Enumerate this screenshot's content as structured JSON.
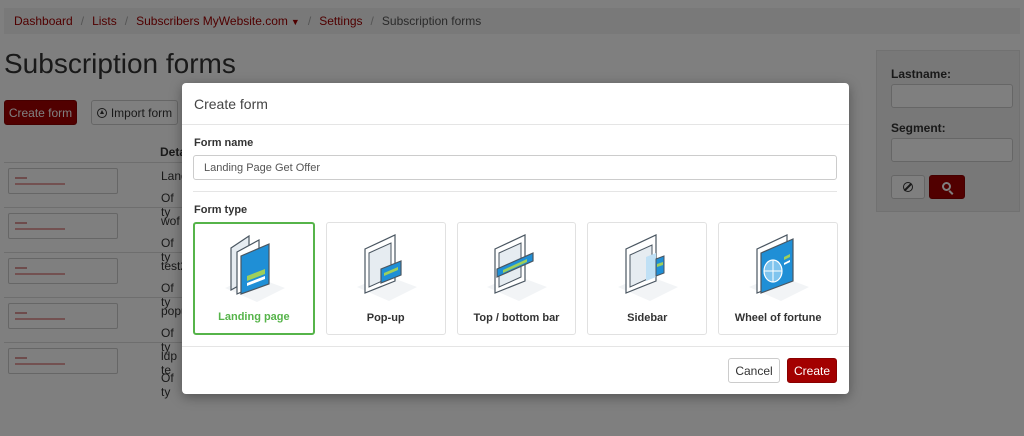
{
  "breadcrumb": {
    "items": [
      "Dashboard",
      "Lists",
      "Subscribers MyWebsite.com",
      "Settings"
    ],
    "current": "Subscription forms"
  },
  "page": {
    "title": "Subscription forms",
    "create_form_label": "Create form",
    "import_form_label": "Import form",
    "table_header_details": "Deta",
    "rows": [
      {
        "name": "Land",
        "type": "Of ty"
      },
      {
        "name": "wof",
        "type": "Of ty"
      },
      {
        "name": "test2",
        "type": "Of ty"
      },
      {
        "name": "popu",
        "type": "Of ty"
      },
      {
        "name": "ldp te",
        "type": "Of ty"
      }
    ]
  },
  "side_panel": {
    "lastname_label": "Lastname:",
    "segment_label": "Segment:"
  },
  "modal": {
    "title": "Create form",
    "form_name_label": "Form name",
    "form_name_value": "Landing Page Get Offer",
    "form_type_label": "Form type",
    "form_types": [
      {
        "label": "Landing page",
        "icon": "landing-page-icon",
        "selected": true
      },
      {
        "label": "Pop-up",
        "icon": "popup-icon",
        "selected": false
      },
      {
        "label": "Top / bottom bar",
        "icon": "top-bottom-bar-icon",
        "selected": false
      },
      {
        "label": "Sidebar",
        "icon": "sidebar-icon",
        "selected": false
      },
      {
        "label": "Wheel of fortune",
        "icon": "wheel-of-fortune-icon",
        "selected": false
      }
    ],
    "cancel_label": "Cancel",
    "create_label": "Create"
  },
  "colors": {
    "brand": "#a30000",
    "selected": "#56b44a",
    "illustration_blue": "#1f8fd6"
  }
}
